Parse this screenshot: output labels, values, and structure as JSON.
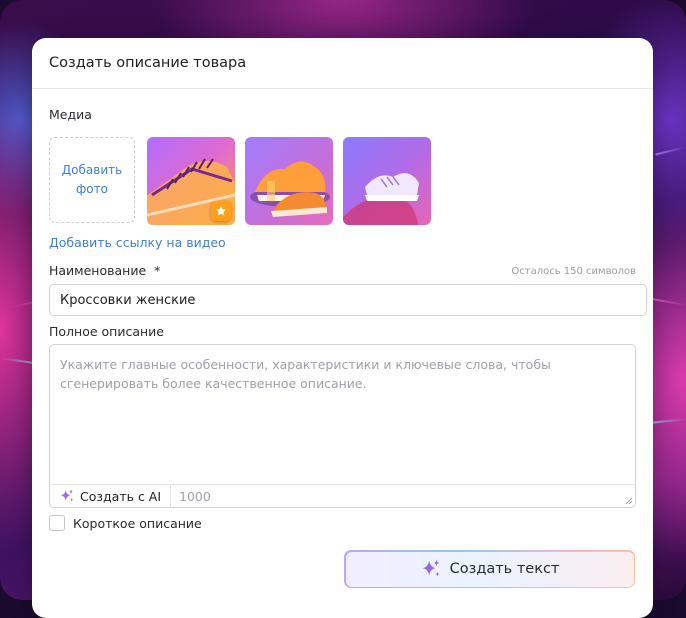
{
  "dialog": {
    "title": "Создать описание товара"
  },
  "media": {
    "label": "Медиа",
    "add_photo_line1": "Добавить",
    "add_photo_line2": "фото",
    "add_video_link": "Добавить ссылку на видео",
    "photos": [
      {
        "icon": "sneaker-photo",
        "is_main": true
      },
      {
        "icon": "sneaker-photo",
        "is_main": false
      },
      {
        "icon": "sneaker-photo",
        "is_main": false
      }
    ]
  },
  "name_field": {
    "label": "Наименование",
    "required_mark": "*",
    "remaining": "Осталось 150 символов",
    "value": "Кроссовки женские"
  },
  "description_field": {
    "label": "Полное описание",
    "placeholder": "Укажите главные особенности, характеристики и ключевые слова, чтобы сгенерировать более качественное описание.",
    "ai_button": "Создать с AI",
    "counter": "1000"
  },
  "short_description": {
    "label": "Короткое описание",
    "checked": false
  },
  "generate_button": {
    "label": "Создать текст"
  },
  "colors": {
    "link": "#3f7ed4",
    "star_badge": "#ff9f1a"
  }
}
